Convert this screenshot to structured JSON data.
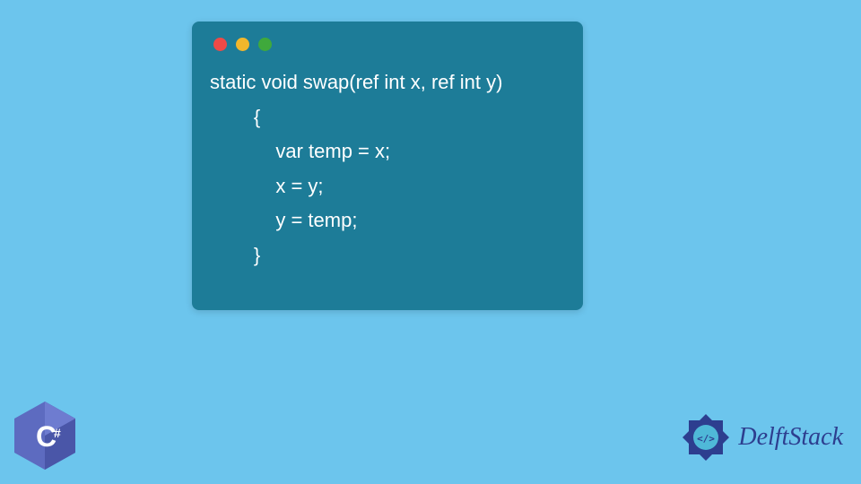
{
  "code": {
    "lines": [
      "static void swap(ref int x, ref int y)",
      "        {",
      "            var temp = x;",
      "            x = y;",
      "            y = temp;",
      "        }"
    ]
  },
  "traffic_lights": {
    "red": "#ee4a47",
    "yellow": "#f2b72c",
    "green": "#3fa93c"
  },
  "badges": {
    "language": "C#",
    "brand": "DelftStack"
  },
  "colors": {
    "page_bg": "#6cc5ed",
    "window_bg": "#1d7c98",
    "code_text": "#ffffff",
    "brand_text": "#2d3e8f",
    "csharp_purple": "#5d6bc0"
  }
}
